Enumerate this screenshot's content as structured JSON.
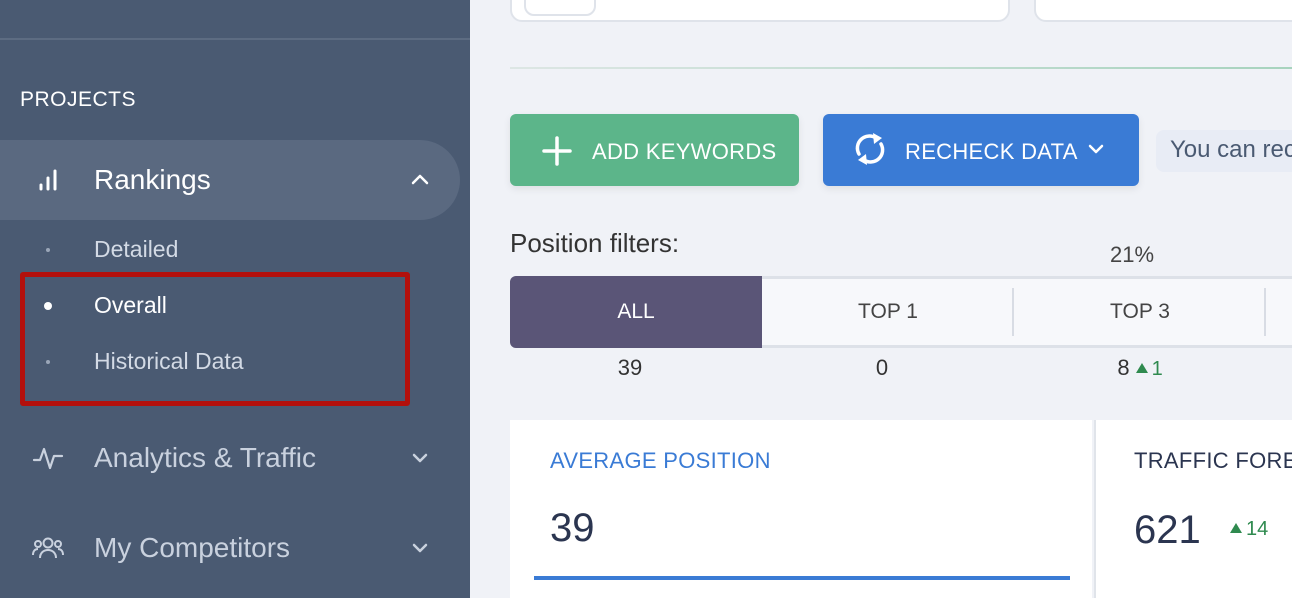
{
  "sidebar": {
    "section_title": "PROJECTS",
    "nav": [
      {
        "label": "Rankings",
        "icon": "bar-chart-icon",
        "expanded": true
      },
      {
        "label": "Analytics & Traffic",
        "icon": "pulse-icon"
      },
      {
        "label": "My Competitors",
        "icon": "people-icon"
      }
    ],
    "sub_items": [
      {
        "label": "Detailed"
      },
      {
        "label": "Overall",
        "active": true
      },
      {
        "label": "Historical Data"
      }
    ],
    "highlight_color": "#b3100c"
  },
  "toolbar": {
    "add_keywords_label": "ADD KEYWORDS",
    "recheck_label": "RECHECK DATA",
    "info_text": "You can rec"
  },
  "filters": {
    "label": "Position filters:",
    "percent_above_top3": "21%",
    "segments": [
      {
        "label": "ALL",
        "count": "39"
      },
      {
        "label": "TOP 1",
        "count": "0"
      },
      {
        "label": "TOP 3",
        "count": "8",
        "change": "1"
      }
    ]
  },
  "stats": {
    "average_position": {
      "title": "AVERAGE POSITION",
      "value": "39"
    },
    "traffic_forecast": {
      "title": "TRAFFIC FOREC",
      "value": "621",
      "change": "14"
    }
  },
  "colors": {
    "sidebar_bg": "#4a5a72",
    "green_button": "#5cb58a",
    "blue_button": "#3a7bd5",
    "active_segment": "#5a5577",
    "positive_change": "#2f8a4f"
  }
}
